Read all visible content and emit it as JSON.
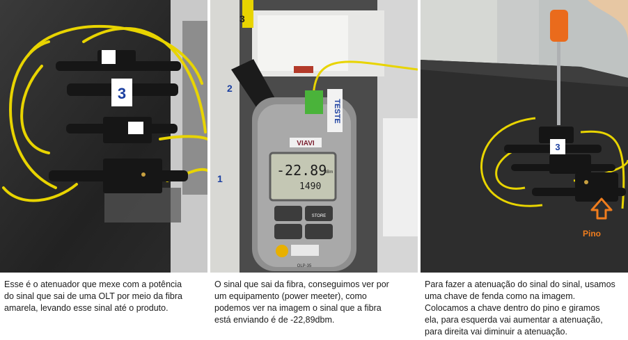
{
  "panels": [
    {
      "caption": "Esse é o atenuador que mexe com a potência\ndo sinal que sai de uma OLT por meio da fibra\namarela, levando esse sinal até o produto.",
      "photo_labels": {
        "box_number": "3"
      }
    },
    {
      "caption": "O sinal que sai da fibra, conseguimos ver por\num equipamento (power meeter), como\npodemos ver na imagem o sinal que a fibra\nestá enviando é de -22,89dbm.",
      "photo_labels": {
        "slot_3": "3",
        "slot_2": "2",
        "slot_1": "1",
        "brand": "VIAVI",
        "reading": "-22.89",
        "unit": "dBm",
        "wavelength": "1490",
        "tag": "TESTE",
        "key_store": "STORE",
        "model": "OLP-35"
      }
    },
    {
      "caption": "Para fazer a atenuação do sinal do sinal, usamos\numa chave de fenda como na imagem.\nColocamos a chave dentro do pino e giramos\nela, para esquerda vai aumentar a atenuação,\npara direita vai diminuir a atenuação.",
      "photo_labels": {
        "pino": "Pino",
        "box_number": "3"
      }
    }
  ],
  "colors": {
    "fiber": "#e8d400",
    "arrow": "#f07d1d",
    "attenuator": "#161616"
  }
}
